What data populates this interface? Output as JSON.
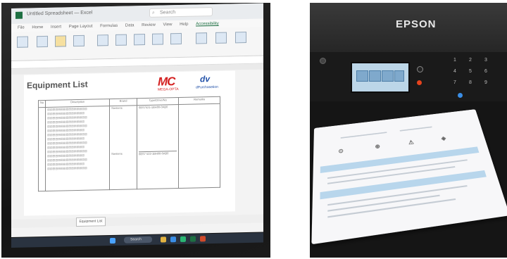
{
  "laptop": {
    "window_title": "Untitled Spreadsheet — Excel",
    "search_placeholder": "Search",
    "menu": [
      "File",
      "Home",
      "Insert",
      "Page Layout",
      "Formulas",
      "Data",
      "Review",
      "View",
      "Help",
      "Accessibility"
    ],
    "sheet_title": "Equipment List",
    "logo_mc": "MC",
    "logo_mc_sub": "MEGA-OPTA",
    "logo_dv": "dv",
    "logo_dv_sub": "dPurchasetion",
    "table_headers": [
      "No",
      "Description",
      "Brand",
      "Type/Drive/No",
      "Remarks"
    ],
    "table_row": {
      "brand": "Siemens",
      "type": "6ES7521-1BH00-0AB0",
      "brand2": "Siemens",
      "type2": "6ES7 522-1BH00-0AB0"
    },
    "sheet_tab": "Equipment List",
    "taskbar_search": "Search"
  },
  "printer": {
    "brand": "EPSON"
  }
}
